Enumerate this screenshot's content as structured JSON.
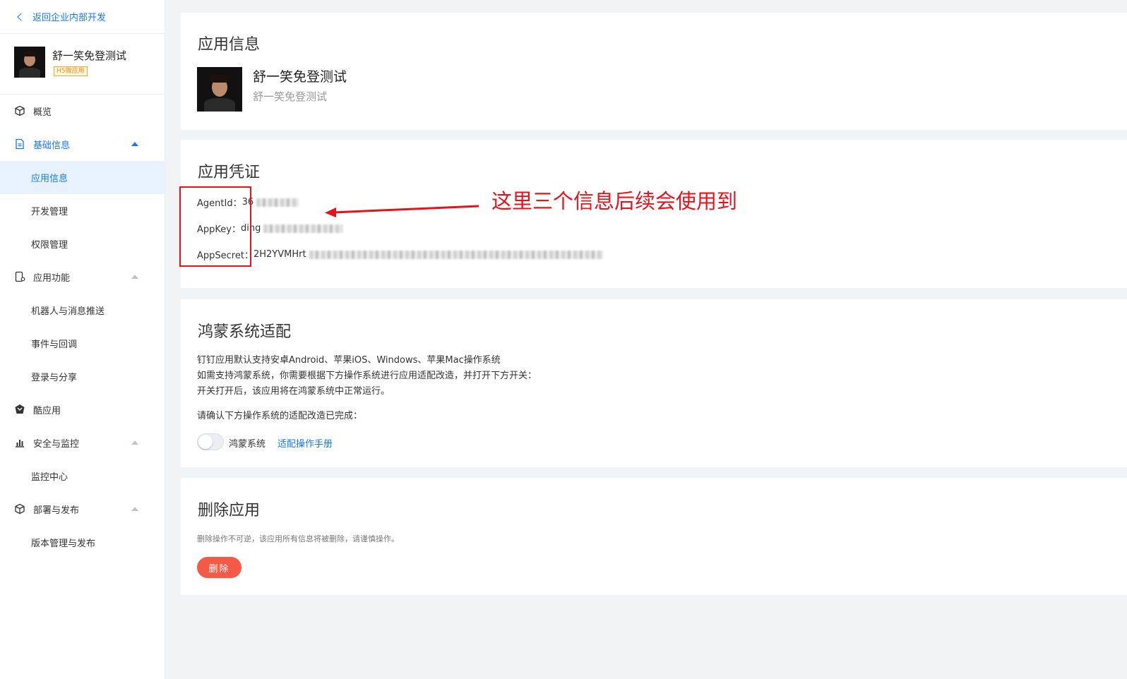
{
  "sidebar": {
    "back_label": "返回企业内部开发",
    "app_name": "舒一笑免登测试",
    "app_tag": "H5微应用",
    "items": [
      {
        "label": "概览",
        "kind": "group",
        "icon": "cube-icon"
      },
      {
        "label": "基础信息",
        "kind": "group",
        "icon": "document-icon",
        "open": true
      },
      {
        "label": "应用信息",
        "kind": "sub",
        "active": true
      },
      {
        "label": "开发管理",
        "kind": "sub"
      },
      {
        "label": "权限管理",
        "kind": "sub"
      },
      {
        "label": "应用功能",
        "kind": "group",
        "icon": "phone-settings-icon"
      },
      {
        "label": "机器人与消息推送",
        "kind": "sub"
      },
      {
        "label": "事件与回调",
        "kind": "sub"
      },
      {
        "label": "登录与分享",
        "kind": "sub"
      },
      {
        "label": "酷应用",
        "kind": "group",
        "icon": "cool-app-icon"
      },
      {
        "label": "安全与监控",
        "kind": "group",
        "icon": "bar-chart-icon"
      },
      {
        "label": "监控中心",
        "kind": "sub"
      },
      {
        "label": "部署与发布",
        "kind": "group",
        "icon": "cube-icon"
      },
      {
        "label": "版本管理与发布",
        "kind": "sub"
      }
    ]
  },
  "app_info": {
    "title": "应用信息",
    "name": "舒一笑免登测试",
    "desc": "舒一笑免登测试"
  },
  "credentials": {
    "title": "应用凭证",
    "agent_id_label": "AgentId：",
    "agent_id_value": "36",
    "app_key_label": "AppKey：",
    "app_key_value": "ding",
    "app_secret_label": "AppSecret：",
    "app_secret_value": "2H2YVMHrt"
  },
  "annotation": {
    "text": "这里三个信息后续会使用到",
    "color": "#e8121b"
  },
  "harmony": {
    "title": "鸿蒙系统适配",
    "line1": "钉钉应用默认支持安卓Android、苹果iOS、Windows、苹果Mac操作系统",
    "line2": "如需支持鸿蒙系统，你需要根据下方操作系统进行应用适配改造，并打开下方开关：",
    "line3": "开关打开后，该应用将在鸿蒙系统中正常运行。",
    "confirm": "请确认下方操作系统的适配改造已完成：",
    "toggle_label": "鸿蒙系统",
    "toggle_on": false,
    "manual_link": "适配操作手册"
  },
  "delete": {
    "title": "删除应用",
    "desc": "删除操作不可逆，该应用所有信息将被删除，请谨慎操作。",
    "button": "删除",
    "button_color": "#f45a45"
  },
  "colors": {
    "accent": "#1677ff",
    "active_bg": "#e8f2ff"
  }
}
